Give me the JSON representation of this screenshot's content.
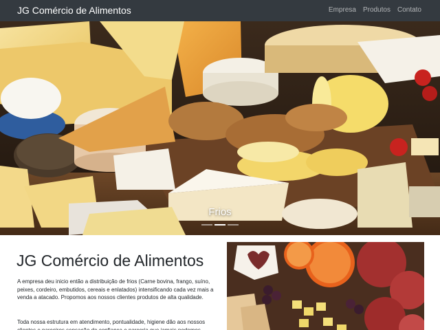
{
  "navbar": {
    "brand": "JG Comércio de Alimentos",
    "links": [
      "Empresa",
      "Produtos",
      "Contato"
    ]
  },
  "carousel": {
    "caption": "Frios",
    "indicator_count": 3,
    "active_index": 1
  },
  "main": {
    "title": "JG Comércio de Alimentos",
    "paragraphs": [
      "A empresa deu inicio então a distribuição de frios (Carne bovina, frango, suíno, peixes, cordeiro, embutidos, cereais e enlatados) intensificando cada vez mais a venda a atacado. Propomos aos nossos clientes produtos de alta qualidade.",
      "Toda nossa estrutura em atendimento, pontualidade, higiene dão aos nossos clientes e parceiros sensação de confiança e parceria que jamais podemos"
    ]
  },
  "colors": {
    "navbar_bg": "#343a40",
    "brand": "#ffffff",
    "nav_link": "#a3a6a9",
    "text": "#212529"
  }
}
